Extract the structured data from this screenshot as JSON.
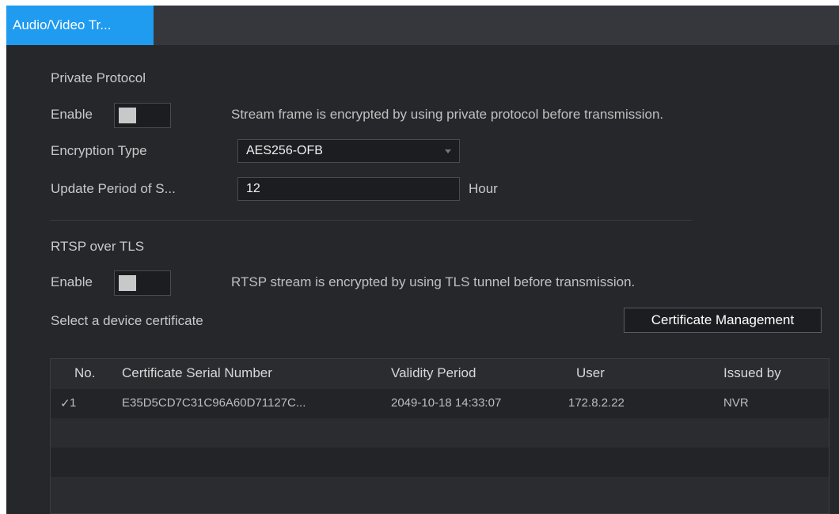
{
  "tab": {
    "label": "Audio/Video Tr..."
  },
  "private_protocol": {
    "title": "Private Protocol",
    "enable_label": "Enable",
    "enable_state": "off",
    "description": "Stream frame is encrypted by using private protocol before transmission.",
    "encryption_type_label": "Encryption Type",
    "encryption_type_value": "AES256-OFB",
    "update_period_label": "Update Period of S...",
    "update_period_value": "12",
    "update_period_unit": "Hour"
  },
  "rtsp_tls": {
    "title": "RTSP over TLS",
    "enable_label": "Enable",
    "enable_state": "off",
    "description": "RTSP stream is encrypted by using TLS tunnel before transmission.",
    "select_cert_label": "Select a device certificate",
    "cert_mgmt_button": "Certificate Management"
  },
  "table": {
    "headers": {
      "no": "No.",
      "serial": "Certificate Serial Number",
      "validity": "Validity Period",
      "user": "User",
      "issued_by": "Issued by"
    },
    "rows": [
      {
        "check": "✓",
        "no": "1",
        "serial": "E35D5CD7C31C96A60D71127C...",
        "validity": "2049-10-18 14:33:07",
        "user": "172.8.2.22",
        "issued_by": "NVR"
      }
    ]
  },
  "colors": {
    "accent": "#1f9bf0",
    "background": "#26272b",
    "tabbar": "#36373c"
  }
}
